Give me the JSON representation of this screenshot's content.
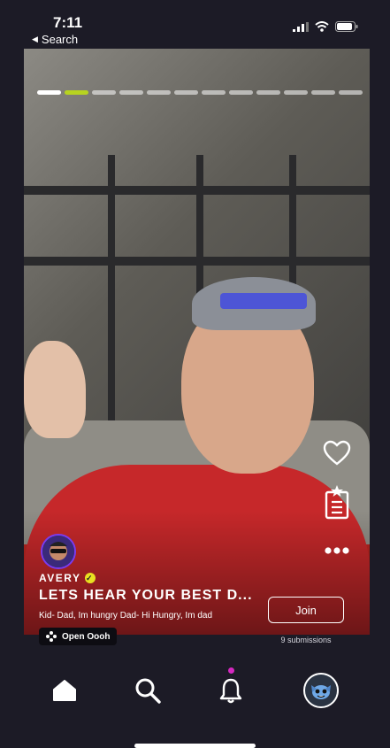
{
  "status_bar": {
    "time": "7:11",
    "back_label": "Search"
  },
  "video": {
    "progress_segments": 12,
    "progress_done": 1,
    "progress_active_index": 1
  },
  "colors": {
    "accent": "#b7d320",
    "verified": "#e8e021",
    "notification": "#d528c0",
    "shirt": "#c6282a",
    "cap_band": "#4d55d6"
  },
  "creator": {
    "name": "AVERY"
  },
  "prompt": {
    "title": "LETS HEAR YOUR BEST D...",
    "body": "Kid-  Dad, Im hungry  Dad-  Hi Hungry, Im dad"
  },
  "join": {
    "label": "Join",
    "submissions": "9 submissions"
  },
  "open_app": {
    "label": "Open Oooh"
  },
  "side_actions": [
    {
      "icon": "heart-icon"
    },
    {
      "icon": "clipboard-star-icon"
    },
    {
      "icon": "more-icon"
    }
  ],
  "tabs": [
    {
      "icon": "home-icon",
      "active": true
    },
    {
      "icon": "search-icon",
      "active": false
    },
    {
      "icon": "bell-icon",
      "active": false,
      "notification": true
    },
    {
      "icon": "profile-avatar",
      "active": false
    }
  ]
}
